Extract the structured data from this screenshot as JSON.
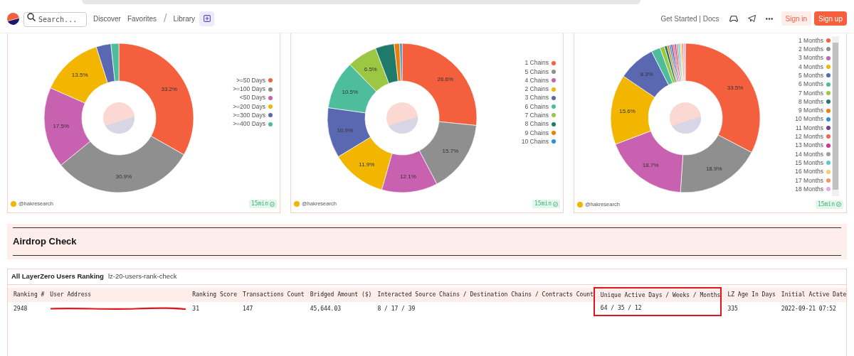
{
  "header": {
    "search": {
      "placeholder": "Search..."
    },
    "nav": [
      "Discover",
      "Favorites",
      "/",
      "Library"
    ],
    "links": "Get Started | Docs",
    "buttons": [
      {
        "label": "Sign in",
        "kind": "secondary"
      },
      {
        "label": "Sign up",
        "kind": "primary"
      }
    ]
  },
  "charts": [
    {
      "chart_data": {
        "type": "donut",
        "categories": [
          ">=50 Days",
          ">=100 Days",
          "<50 Days",
          ">=200 Days",
          ">=300 Days",
          ">=400 Days"
        ],
        "series": [
          {
            "values": [
              33.2,
              30.9,
              17.5,
              13.5,
              3.2,
              1.7
            ]
          }
        ],
        "colors": [
          "#f4603e",
          "#8f8f8f",
          "#c862b0",
          "#f2b600",
          "#5a67b1",
          "#4dbd9c"
        ],
        "value_labels": [
          "33.2%",
          "30.9%",
          "17.5%",
          "13.5%",
          null,
          null
        ]
      },
      "author": "@hakresearch",
      "refresh": "15min",
      "legend_scroll": false
    },
    {
      "chart_data": {
        "type": "donut",
        "categories": [
          "1 Chains",
          "5 Chains",
          "4 Chains",
          "2 Chains",
          "3 Chains",
          "6 Chains",
          "7 Chains",
          "8 Chains",
          "9 Chains",
          "10 Chains"
        ],
        "series": [
          {
            "values": [
              26.6,
              15.7,
              12.1,
              11.9,
              10.9,
              10.5,
              6.5,
              4.1,
              1.2,
              0.5
            ]
          }
        ],
        "colors": [
          "#f4603e",
          "#8f8f8f",
          "#c862b0",
          "#f2b600",
          "#5a67b1",
          "#4dbd9c",
          "#9bc743",
          "#1f7a6a",
          "#e9800b",
          "#2b8fd9"
        ],
        "value_labels": [
          "26.6%",
          "15.7%",
          "12.1%",
          "11.9%",
          "10.9%",
          "10.5%",
          "6.5%",
          null,
          null,
          null
        ]
      },
      "author": "@hakresearch",
      "refresh": "15min",
      "legend_scroll": false
    },
    {
      "chart_data": {
        "type": "donut",
        "categories": [
          "1 Months",
          "2 Months",
          "3 Months",
          "4 Months",
          "5 Months",
          "6 Months",
          "7 Months",
          "8 Months",
          "9 Months",
          "10 Months",
          "11 Months",
          "12 Months",
          "13 Months",
          "14 Months",
          "15 Months",
          "16 Months",
          "17 Months",
          "18 Months"
        ],
        "series": [
          {
            "values": [
              33.5,
              18.9,
              18.7,
              15.6,
              8.3,
              2.0,
              1.0,
              0.6,
              0.45,
              0.4,
              0.4,
              0.4,
              0.4,
              0.4,
              0.4,
              0.4,
              0.4,
              0.4
            ]
          }
        ],
        "colors": [
          "#f4603e",
          "#8f8f8f",
          "#c862b0",
          "#f2b600",
          "#5a67b1",
          "#4dbd9c",
          "#9bc743",
          "#1f7a6a",
          "#e9800b",
          "#2b8fd9",
          "#6b3fa0",
          "#f06554",
          "#d43690",
          "#a0a096",
          "#55c9d6",
          "#f9cb6a",
          "#f5926b",
          "#e2a8ec"
        ],
        "value_labels": [
          "33.5%",
          "18.9%",
          "18.7%",
          "15.6%",
          "8.3%",
          null,
          null,
          null,
          null,
          null,
          null,
          null,
          null,
          null,
          null,
          null,
          null,
          null
        ]
      },
      "author": "@hakresearch",
      "refresh": "15min",
      "legend_scroll": true
    }
  ],
  "section": {
    "title": "Airdrop Check"
  },
  "table_card": {
    "title": "All LayerZero Users Ranking",
    "tab": "lz-20-users-rank-check",
    "columns": [
      {
        "label": "Ranking #",
        "highlighted": false
      },
      {
        "label": "User Address",
        "highlighted": false
      },
      {
        "label": "Ranking Score",
        "highlighted": false
      },
      {
        "label": "Transactions Count",
        "highlighted": false
      },
      {
        "label": "Bridged Amount ($)",
        "highlighted": false
      },
      {
        "label": "Interacted Source Chains / Destination Chains / Contracts Count",
        "highlighted": false
      },
      {
        "label": "Unique Active Days / Weeks / Months",
        "highlighted": true
      },
      {
        "label": "LZ Age In Days",
        "highlighted": false
      },
      {
        "label": "Initial Active Date",
        "highlighted": false
      }
    ],
    "rows": [
      {
        "cells": [
          {
            "kind": "text",
            "text": "2948"
          },
          {
            "kind": "redacted"
          },
          {
            "kind": "text",
            "text": "31"
          },
          {
            "kind": "text",
            "text": "147"
          },
          {
            "kind": "text",
            "text": "45,644.03"
          },
          {
            "kind": "text",
            "text": "8 / 17 / 39"
          },
          {
            "kind": "text",
            "text": "64 / 35 / 12"
          },
          {
            "kind": "text",
            "text": "335"
          },
          {
            "kind": "text",
            "text": "2022-09-21 07:52"
          }
        ]
      }
    ]
  }
}
